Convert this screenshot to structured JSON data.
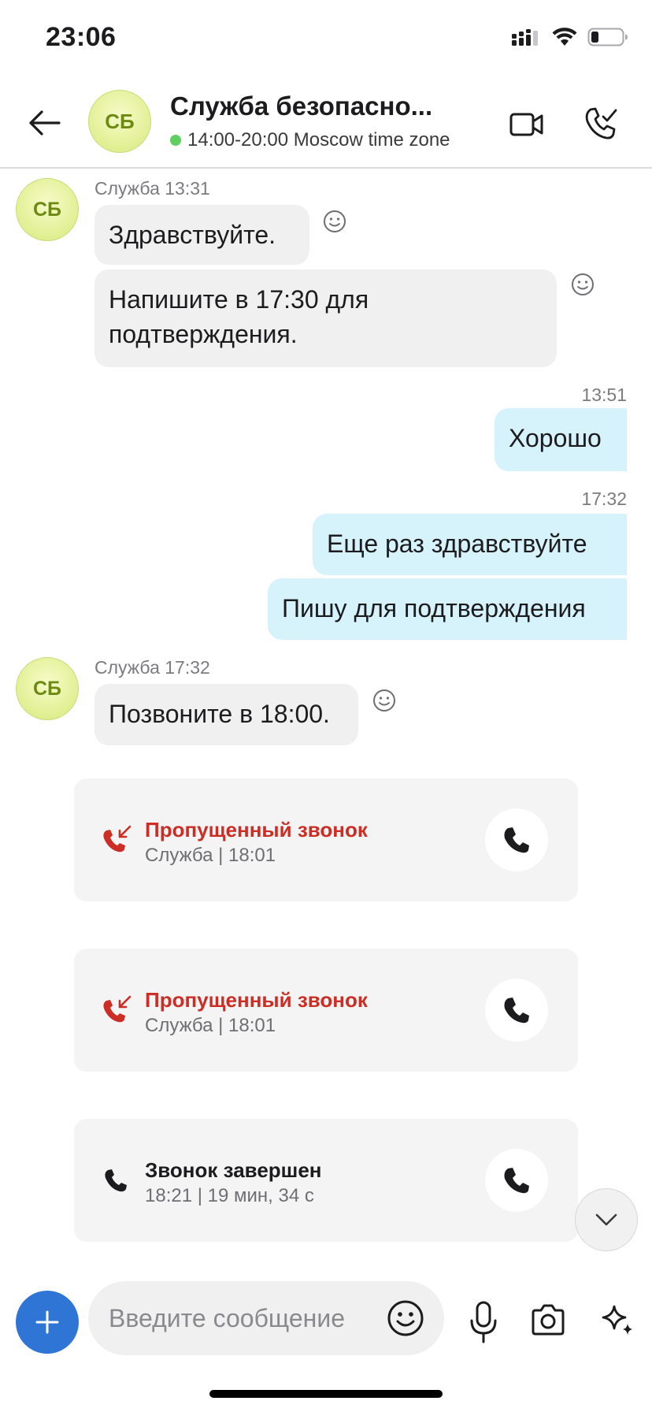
{
  "status_bar": {
    "time": "23:06"
  },
  "header": {
    "avatar_initials": "СБ",
    "title": "Служба безопасно...",
    "subtitle": "14:00-20:00 Moscow time zone"
  },
  "messages": {
    "group1": {
      "avatar_initials": "СБ",
      "meta": "Служба 13:31",
      "bubble1": "Здравствуйте.",
      "bubble2": "Напишите в 17:30 для подтверждения."
    },
    "out1": {
      "time": "13:51",
      "text": "Хорошо"
    },
    "out2": {
      "time": "17:32",
      "text1": "Еще раз здравствуйте",
      "text2": "Пишу для подтверждения"
    },
    "group2": {
      "avatar_initials": "СБ",
      "meta": "Служба 17:32",
      "bubble1": "Позвоните в 18:00."
    }
  },
  "calls": [
    {
      "title": "Пропущенный звонок",
      "subtitle": "Служба | 18:01",
      "status": "missed"
    },
    {
      "title": "Пропущенный звонок",
      "subtitle": "Служба | 18:01",
      "status": "missed"
    },
    {
      "title": "Звонок завершен",
      "subtitle": "18:21 | 19 мин, 34 с",
      "status": "completed"
    }
  ],
  "composer": {
    "placeholder": "Введите сообщение",
    "value": ""
  },
  "colors": {
    "accent": "#2f75d6",
    "missed": "#cc2d24",
    "outgoing_bubble": "#d6f3fb",
    "incoming_bubble": "#f0f0f0",
    "online": "#5fcf62"
  }
}
